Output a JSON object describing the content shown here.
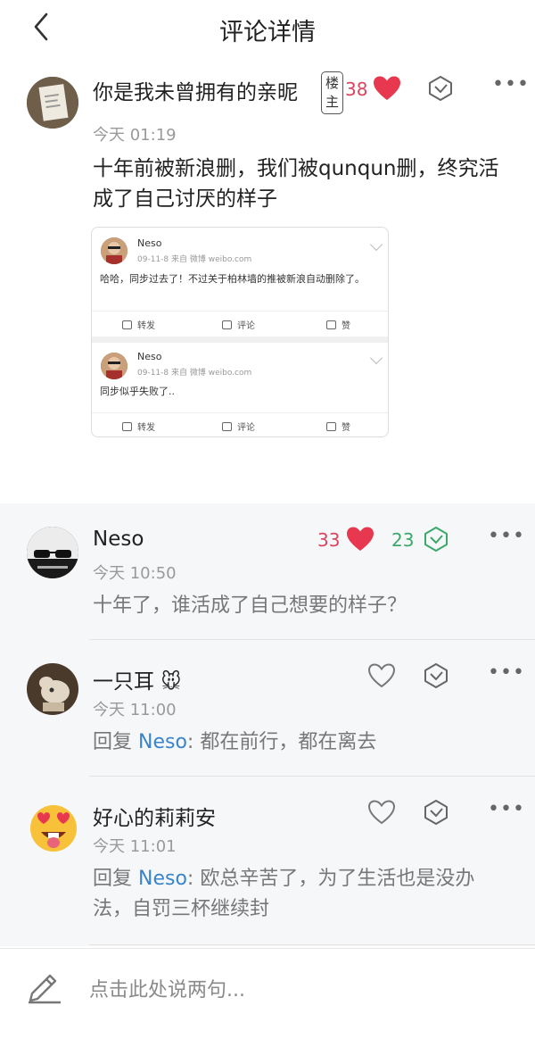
{
  "header": {
    "title": "评论详情",
    "back_icon": "chevron-left-icon"
  },
  "post": {
    "username": "你是我未曾拥有的亲昵",
    "op_badge": "楼主",
    "likes": "38",
    "time": "今天 01:19",
    "text": "十年前被新浪删，我们被qunqun删，终究活成了自己讨厌的样子",
    "embed": {
      "items": [
        {
          "name": "Neso",
          "meta": "09-11-8   来自 微博 weibo.com",
          "text": "哈哈，同步过去了！不过关于柏林墙的推被新浪自动删除了。"
        },
        {
          "name": "Neso",
          "meta": "09-11-8   来自 微博 weibo.com",
          "text": "同步似乎失败了.."
        }
      ],
      "actions": {
        "repost": "转发",
        "comment": "评论",
        "like": "赞"
      }
    }
  },
  "comments": [
    {
      "username": "Neso",
      "time": "今天 10:50",
      "likes": "33",
      "upvotes": "23",
      "text": "十年了，谁活成了自己想要的样子？"
    },
    {
      "username": "一只耳",
      "time": "今天 11:00",
      "reply_prefix": "回复 ",
      "mention": "Neso",
      "text": ": 都在前行，都在离去"
    },
    {
      "username": "好心的莉莉安",
      "time": "今天 11:01",
      "reply_prefix": "回复 ",
      "mention": "Neso",
      "text": ": 欧总辛苦了，为了生活也是没办法，自罚三杯继续封"
    }
  ],
  "input": {
    "placeholder": "点击此处说两句..."
  },
  "colors": {
    "like_red": "#d9455f",
    "upvote_green": "#3aa86a",
    "mention_blue": "#3a84c9"
  }
}
